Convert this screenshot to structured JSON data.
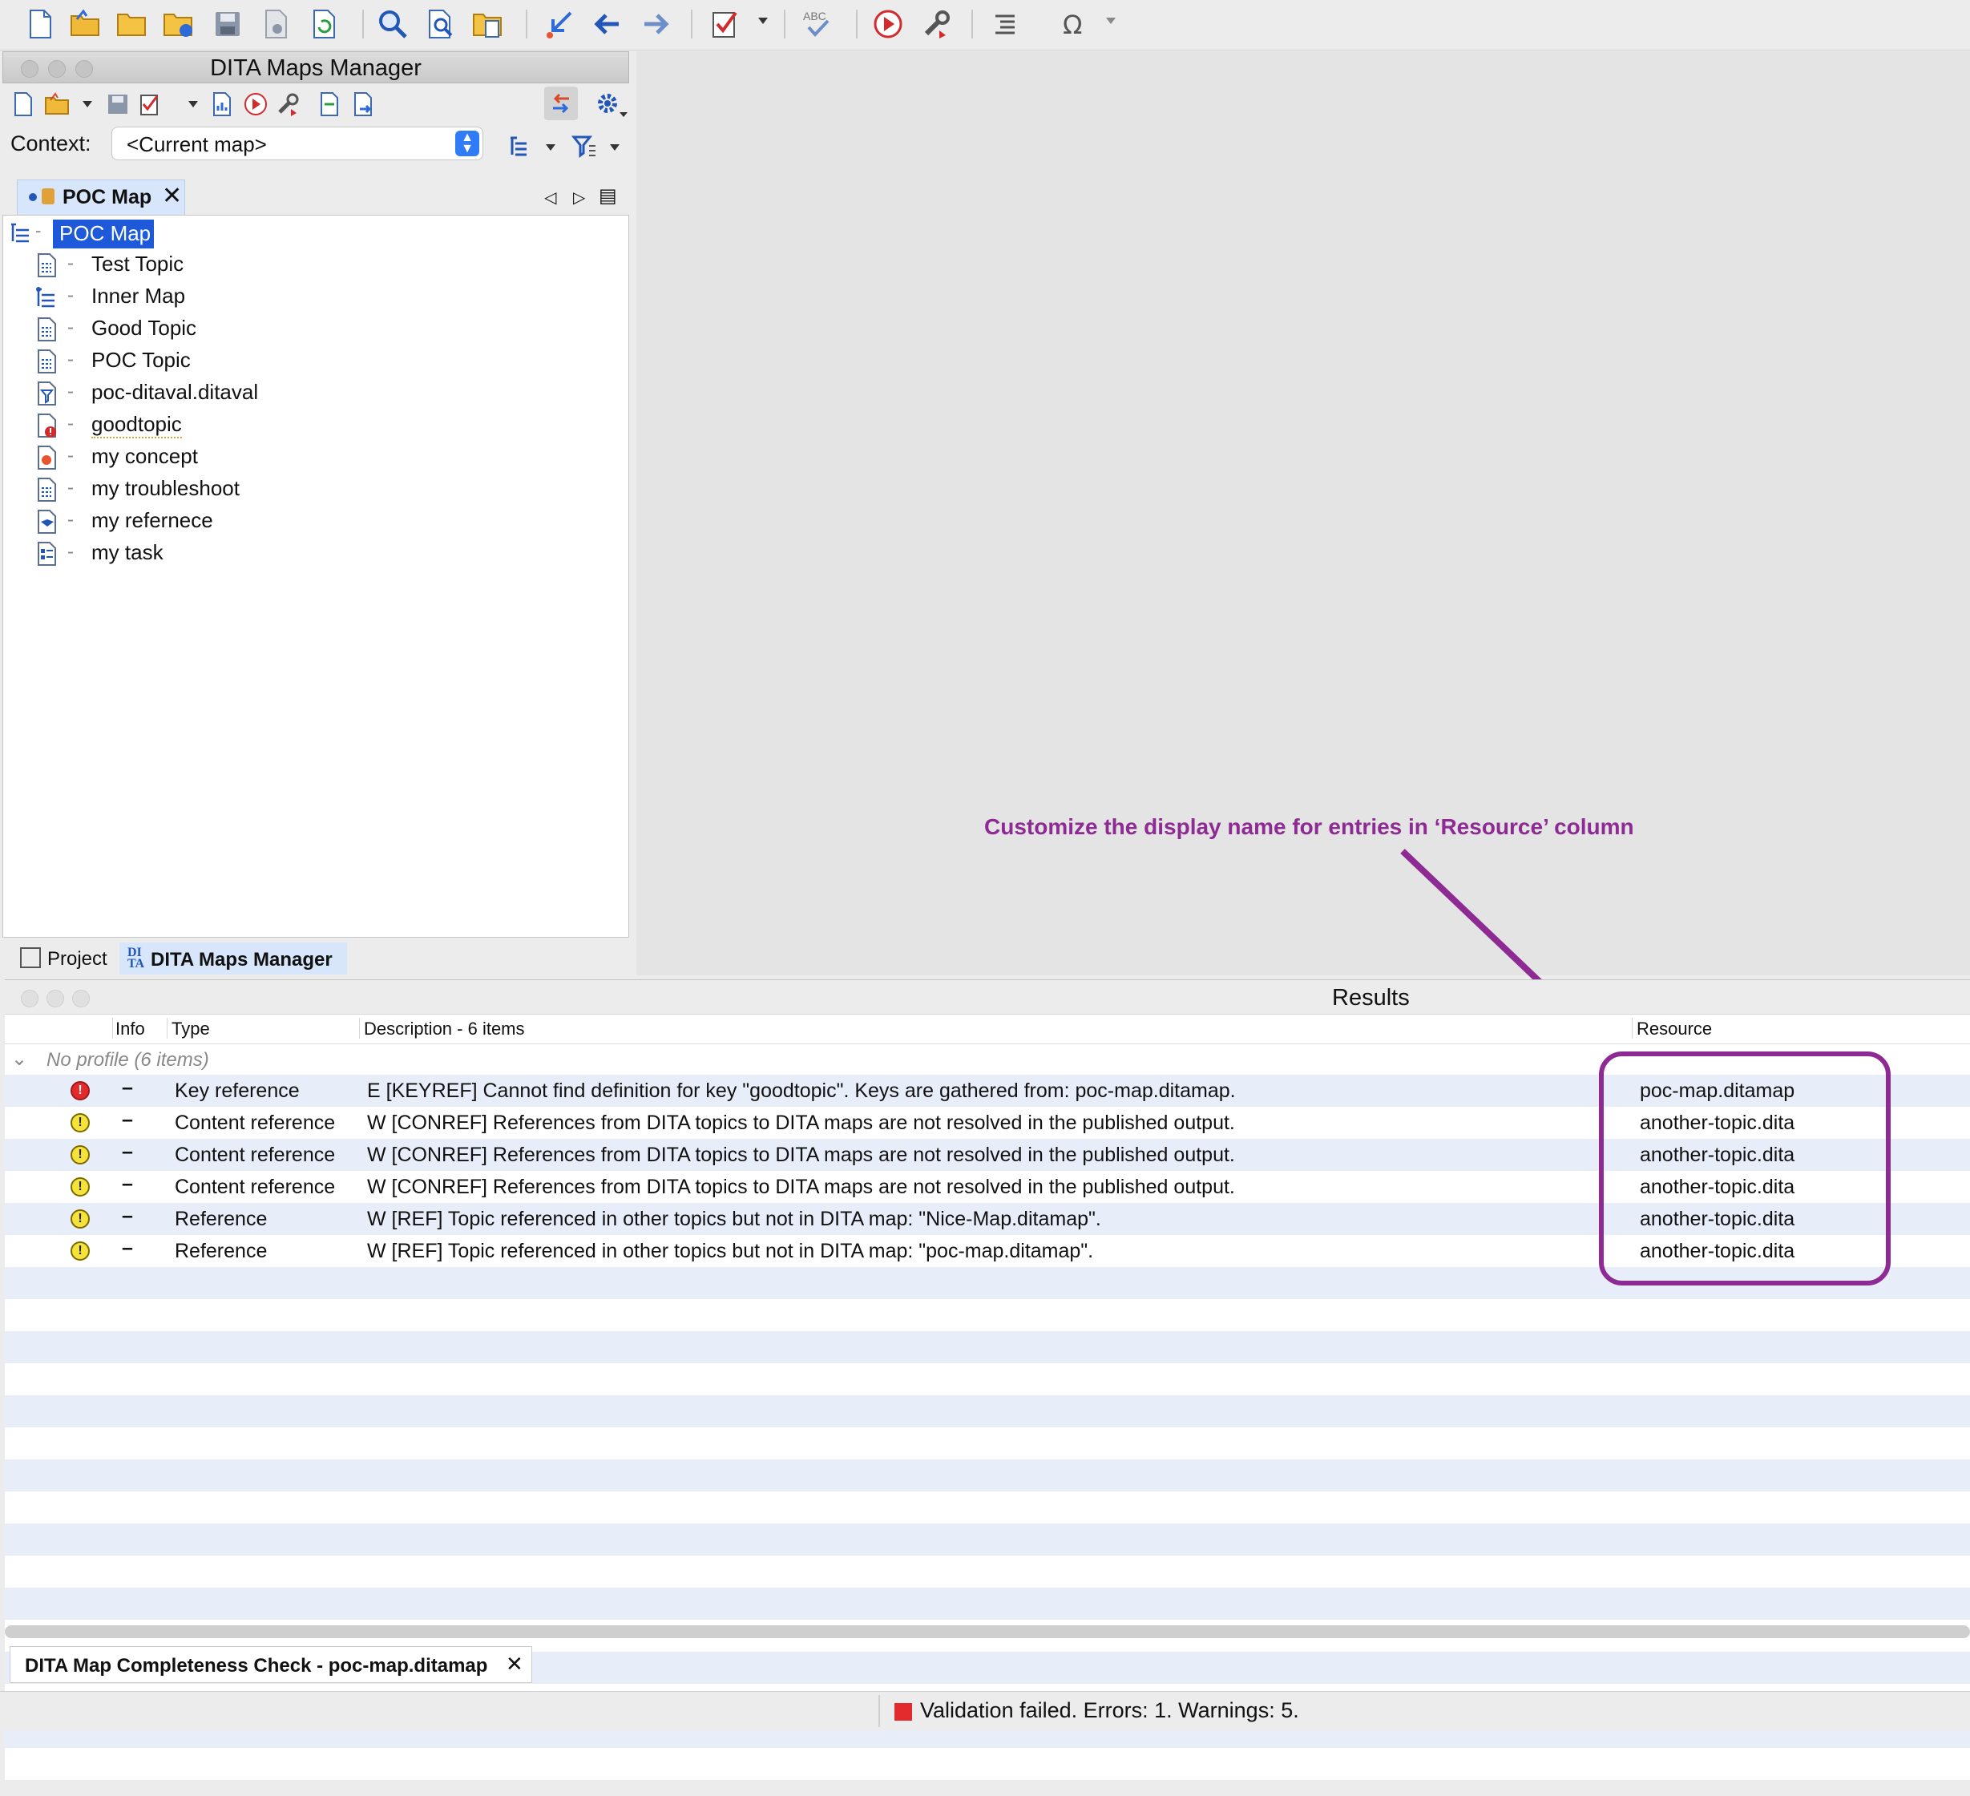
{
  "toolbar": {
    "icons": [
      "new-document-icon",
      "open-folder-icon",
      "folder-icon",
      "open-url-icon",
      "save-icon",
      "save-all-icon",
      "reload-icon",
      "find-icon",
      "find-in-files-icon",
      "open-file-icon",
      "goto-icon",
      "back-arrow-icon",
      "forward-arrow-icon",
      "validate-icon",
      "spellcheck-icon",
      "transform-icon",
      "configure-transform-icon",
      "format-indent-icon",
      "special-character-icon"
    ]
  },
  "dmm": {
    "title": "DITA Maps Manager",
    "context_label": "Context:",
    "context_value": "<Current map>",
    "tab_label": "POC Map",
    "tab_close": "✕",
    "root": "POC Map",
    "nodes": [
      {
        "label": "Test Topic",
        "icon": "topic-icon"
      },
      {
        "label": "Inner Map",
        "icon": "map-icon"
      },
      {
        "label": "Good Topic",
        "icon": "topic-icon"
      },
      {
        "label": "POC Topic",
        "icon": "topic-icon"
      },
      {
        "label": "poc-ditaval.ditaval",
        "icon": "ditaval-icon"
      },
      {
        "label": "goodtopic",
        "icon": "broken-topic-icon"
      },
      {
        "label": "my concept",
        "icon": "concept-icon"
      },
      {
        "label": "my troubleshoot",
        "icon": "troubleshooting-icon"
      },
      {
        "label": "my refernece",
        "icon": "reference-icon"
      },
      {
        "label": "my task",
        "icon": "task-icon"
      }
    ],
    "bottom_tabs": {
      "project": "Project",
      "dmm": "DITA Maps Manager"
    }
  },
  "annotation": "Customize the display name for entries in ‘Resource’ column",
  "results": {
    "title": "Results",
    "columns": {
      "info": "Info",
      "type": "Type",
      "description": "Description - 6 items",
      "resource": "Resource"
    },
    "group": "No profile (6 items)",
    "rows": [
      {
        "severity": "error",
        "mark": "–",
        "type": "Key reference",
        "description": "E [KEYREF] Cannot find definition for key \"goodtopic\". Keys are gathered from: poc-map.ditamap.",
        "resource": "poc-map.ditamap"
      },
      {
        "severity": "warning",
        "mark": "–",
        "type": "Content reference",
        "description": "W [CONREF] References from DITA topics to DITA maps are not resolved in the published output.",
        "resource": "another-topic.dita"
      },
      {
        "severity": "warning",
        "mark": "–",
        "type": "Content reference",
        "description": "W [CONREF] References from DITA topics to DITA maps are not resolved in the published output.",
        "resource": "another-topic.dita"
      },
      {
        "severity": "warning",
        "mark": "–",
        "type": "Content reference",
        "description": "W [CONREF] References from DITA topics to DITA maps are not resolved in the published output.",
        "resource": "another-topic.dita"
      },
      {
        "severity": "warning",
        "mark": "–",
        "type": "Reference",
        "description": "W [REF] Topic referenced in other topics but not in DITA map: \"Nice-Map.ditamap\".",
        "resource": "another-topic.dita"
      },
      {
        "severity": "warning",
        "mark": "–",
        "type": "Reference",
        "description": "W [REF] Topic referenced in other topics but not in DITA map: \"poc-map.ditamap\".",
        "resource": "another-topic.dita"
      }
    ],
    "tab_label": "DITA Map Completeness Check - poc-map.ditamap",
    "tab_close": "✕"
  },
  "status": "Validation failed. Errors: 1. Warnings: 5.",
  "colors": {
    "annotation": "#8e2a93",
    "selection": "#1d59d8",
    "error": "#e32b2b",
    "warning": "#f5e23a",
    "stripe": "#e8eef9"
  }
}
